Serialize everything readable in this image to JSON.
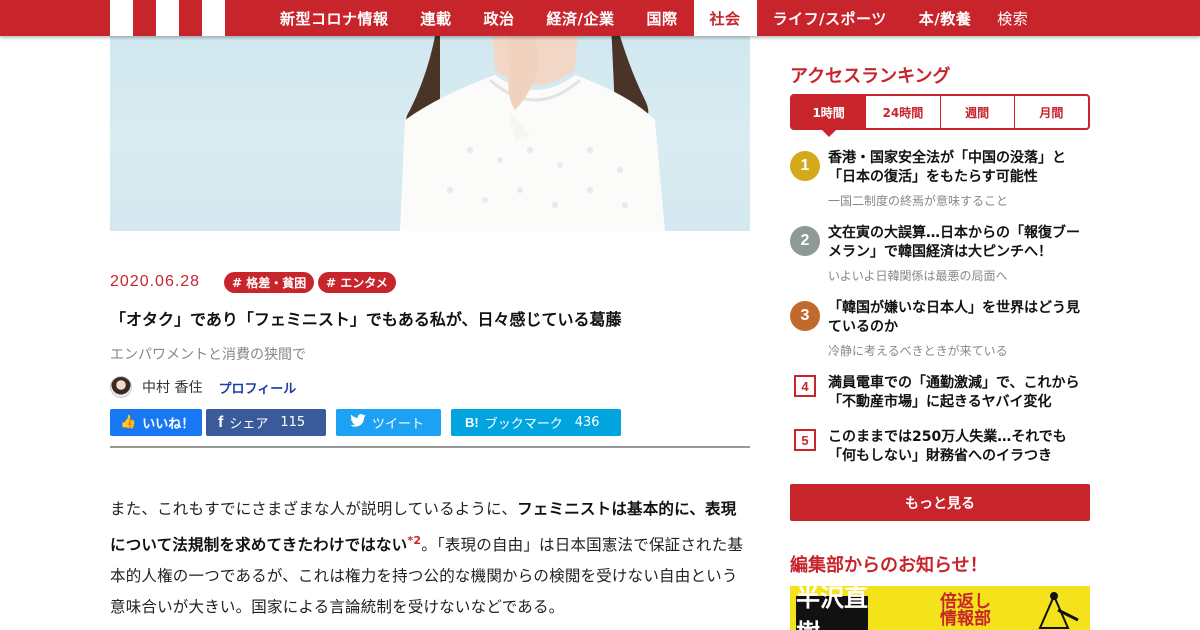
{
  "nav": {
    "items": [
      "新型コロナ情報",
      "連載",
      "政治",
      "経済/企業",
      "国際",
      "社会",
      "ライフ/スポーツ",
      "本/教養"
    ],
    "active": "社会",
    "search_label": "検索"
  },
  "article": {
    "date": "2020.06.28",
    "tags": [
      "# 格差・貧困",
      "# エンタメ"
    ],
    "title": "「オタク」であり「フェミニスト」でもある私が、日々感じている葛藤",
    "subtitle": "エンパワメントと消費の狭間で",
    "author_name": "中村 香住",
    "profile_label": "プロフィール",
    "share": {
      "like_label": "いいね！",
      "facebook_label": "シェア",
      "facebook_count": "115",
      "twitter_label": "ツイート",
      "hatena_label": "ブックマーク",
      "hatena_count": "436"
    },
    "body": {
      "p1_start": "また、これもすでにさまざまな人が説明しているように、",
      "p1_bold": "フェミニストは基本的に、表現について法規制を求めてきたわけではない",
      "p1_footnote": "*2",
      "p1_end": "。「表現の自由」は日本国憲法で保証された基本的人権の一つであるが、これは権力を持つ公的な機関からの検閲を受けない自由という意味合いが大きい。国家による言論統制を受けないなどである。"
    }
  },
  "sidebar": {
    "ranking_title": "アクセスランキング",
    "tabs": [
      "1時間",
      "24時間",
      "週間",
      "月間"
    ],
    "active_tab": "1時間",
    "items": [
      {
        "rank": "1",
        "title": "香港・国家安全法が「中国の没落」と「日本の復活」をもたらす可能性",
        "sub": "一国二制度の終焉が意味すること",
        "color": "#d4a91a"
      },
      {
        "rank": "2",
        "title": "文在寅の大誤算…日本からの「報復ブーメラン」で韓国経済は大ピンチへ！",
        "sub": "いよいよ日韓関係は最悪の局面へ",
        "color": "#8e9a94"
      },
      {
        "rank": "3",
        "title": "「韓国が嫌いな日本人」を世界はどう見ているのか",
        "sub": "冷静に考えるべきときが来ている",
        "color": "#c26a2e"
      },
      {
        "rank": "4",
        "title": "満員電車での「通勤激減」で、これから「不動産市場」に起きるヤバイ変化"
      },
      {
        "rank": "5",
        "title": "このままでは250万人失業…それでも「何もしない」財務省へのイラつき"
      }
    ],
    "more_label": "もっと見る",
    "notice_title": "編集部からのお知らせ！",
    "banner": {
      "main": "半沢直樹",
      "sub1": "倍返し",
      "sub2": "情報部"
    }
  },
  "colors": {
    "brand": "#c8242c"
  }
}
